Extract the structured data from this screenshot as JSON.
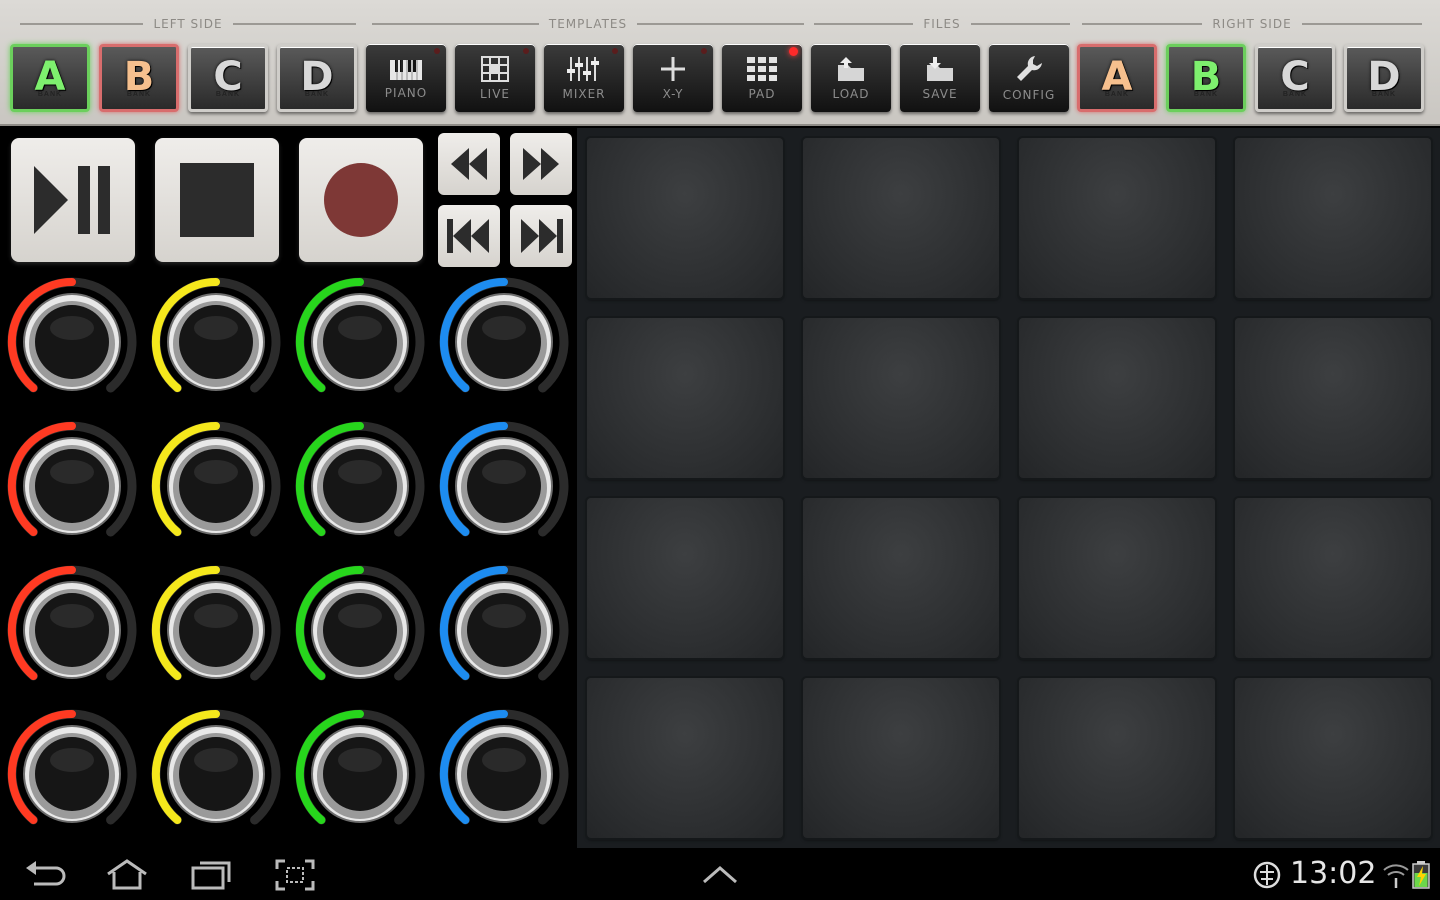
{
  "sections": {
    "left_side": "LEFT SIDE",
    "templates": "TEMPLATES",
    "files": "FILES",
    "right_side": "RIGHT SIDE"
  },
  "left_banks": [
    {
      "letter": "A",
      "sub": "BANK",
      "state": "active"
    },
    {
      "letter": "B",
      "sub": "BANK",
      "state": "selected"
    },
    {
      "letter": "C",
      "sub": "BANK",
      "state": "inactive"
    },
    {
      "letter": "D",
      "sub": "BANK",
      "state": "inactive"
    }
  ],
  "templates": [
    {
      "label": "PIANO",
      "icon": "piano-icon",
      "active": false
    },
    {
      "label": "LIVE",
      "icon": "grid-icon",
      "active": false
    },
    {
      "label": "MIXER",
      "icon": "mixer-icon",
      "active": false
    },
    {
      "label": "X-Y",
      "icon": "crosshair-icon",
      "active": false
    },
    {
      "label": "PAD",
      "icon": "pad-icon",
      "active": true
    }
  ],
  "files": [
    {
      "label": "LOAD",
      "icon": "load-icon"
    },
    {
      "label": "SAVE",
      "icon": "save-icon"
    },
    {
      "label": "CONFIG",
      "icon": "wrench-icon"
    }
  ],
  "right_banks": [
    {
      "letter": "A",
      "sub": "BANK",
      "state": "selected"
    },
    {
      "letter": "B",
      "sub": "BANK",
      "state": "active"
    },
    {
      "letter": "C",
      "sub": "BANK",
      "state": "inactive"
    },
    {
      "letter": "D",
      "sub": "BANK",
      "state": "inactive"
    }
  ],
  "transport": {
    "play_pause": "play-pause-icon",
    "stop": "stop-icon",
    "record": "record-icon",
    "rewind": "rewind-icon",
    "fast_forward": "fast-forward-icon",
    "skip_start": "skip-to-start-icon",
    "skip_end": "skip-to-end-icon"
  },
  "knob_colors": [
    "#ff3a22",
    "#f5e81c",
    "#27d61c",
    "#1d8cf0"
  ],
  "knob_rows": 4,
  "pad_rows": 4,
  "pad_cols": 4,
  "system": {
    "time": "13:02",
    "colors": {
      "toolbar": "#d4d1cc",
      "pad": "#2f3133",
      "record": "#7e3836"
    }
  }
}
